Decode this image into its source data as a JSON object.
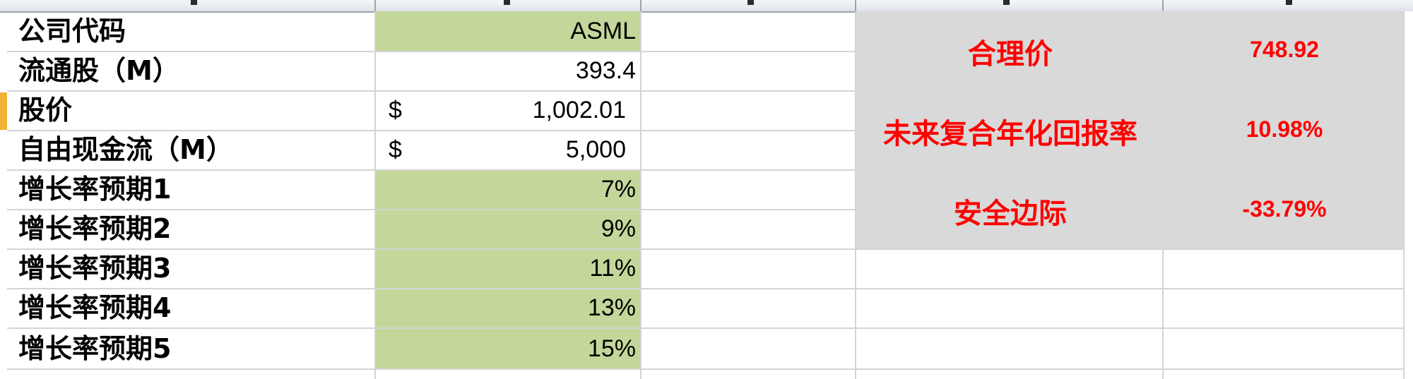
{
  "rows": [
    {
      "label": "公司代码",
      "value": "ASML"
    },
    {
      "label": "流通股（M）",
      "value": "393.4"
    },
    {
      "label": "股价",
      "currency": "$",
      "value": "1,002.01"
    },
    {
      "label": "自由现金流（M）",
      "currency": "$",
      "value": "5,000"
    },
    {
      "label": "增长率预期1",
      "value": "7%"
    },
    {
      "label": "增长率预期2",
      "value": "9%"
    },
    {
      "label": "增长率预期3",
      "value": "11%"
    },
    {
      "label": "增长率预期4",
      "value": "13%"
    },
    {
      "label": "增长率预期5",
      "value": "15%"
    }
  ],
  "results": [
    {
      "label": "合理价",
      "value": "748.92"
    },
    {
      "label": "未来复合年化回报率",
      "value": "10.98%"
    },
    {
      "label": "安全边际",
      "value": "-33.79%"
    }
  ],
  "colors": {
    "input_fill": "#c4d79b",
    "result_panel": "#d9d9d9",
    "result_text": "#ff0000",
    "selected_row_marker": "#f2b233"
  }
}
